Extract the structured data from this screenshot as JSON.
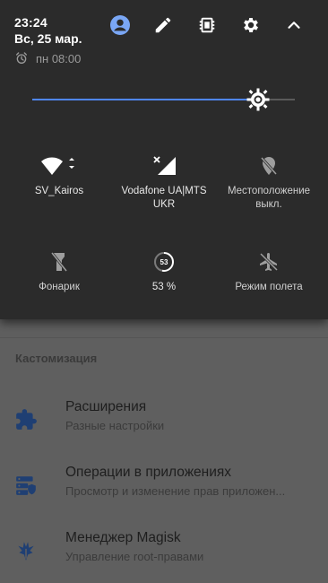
{
  "status": {
    "time": "23:24",
    "date": "Вс, 25 мар.",
    "alarm": "пн 08:00"
  },
  "header_icons": [
    "account-icon",
    "edit-icon",
    "memory-icon",
    "settings-icon",
    "collapse-icon"
  ],
  "brightness": {
    "level": 0.86
  },
  "tiles": [
    {
      "label": "SV_Kairos",
      "icon": "wifi-icon"
    },
    {
      "label": "Vodafone UA|MTS UKR",
      "icon": "cellular-signal-icon"
    },
    {
      "label": "Местоположение выкл.",
      "icon": "location-off-icon"
    },
    {
      "label": "Фонарик",
      "icon": "flashlight-icon"
    },
    {
      "label": "53 %",
      "icon": "battery-icon",
      "badge": "53"
    },
    {
      "label": "Режим полета",
      "icon": "airplane-icon"
    }
  ],
  "settings": {
    "section_title": "Кастомизация",
    "items": [
      {
        "title": "Расширения",
        "subtitle": "Разные настройки",
        "icon": "puzzle-icon"
      },
      {
        "title": "Операции в приложениях",
        "subtitle": "Просмотр и изменение прав приложен...",
        "icon": "app-ops-icon"
      },
      {
        "title": "Менеджер Magisk",
        "subtitle": "Управление root-правами",
        "icon": "magisk-icon"
      }
    ]
  },
  "colors": {
    "accent": "#4f86f7",
    "panel": "#2b2b2b",
    "scrim": "#5f5f5f",
    "list_icon": "#1f3f73"
  }
}
